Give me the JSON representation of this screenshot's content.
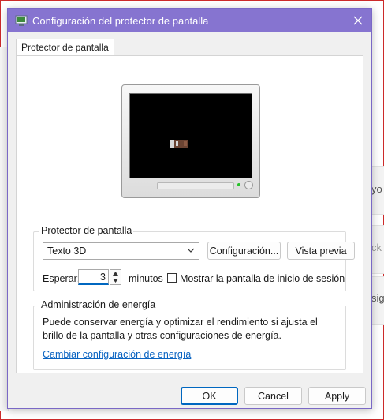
{
  "window": {
    "title": "Configuración del protector de pantalla"
  },
  "tabs": [
    {
      "label": "Protector de pantalla"
    }
  ],
  "screensaver_group": {
    "label": "Protector de pantalla",
    "selected": "Texto 3D",
    "settings_button": "Configuración...",
    "preview_button": "Vista previa",
    "wait_label": "Esperar:",
    "wait_value": "3",
    "minutes_label": "minutos",
    "show_logon_label": "Mostrar la pantalla de inicio de sesión al re"
  },
  "energy_group": {
    "label": "Administración de energía",
    "description": "Puede conservar energía y optimizar el rendimiento si ajusta el brillo de la pantalla y otras configuraciones de energía.",
    "link": "Cambiar configuración de energía"
  },
  "buttons": {
    "ok": "OK",
    "cancel": "Cancel",
    "apply": "Apply"
  },
  "background": {
    "fragment_1": "yo",
    "fragment_2": "ck",
    "fragment_3": "sig"
  },
  "colors": {
    "titlebar": "#8674d0",
    "accent": "#0067c0",
    "link": "#0a64c2"
  }
}
